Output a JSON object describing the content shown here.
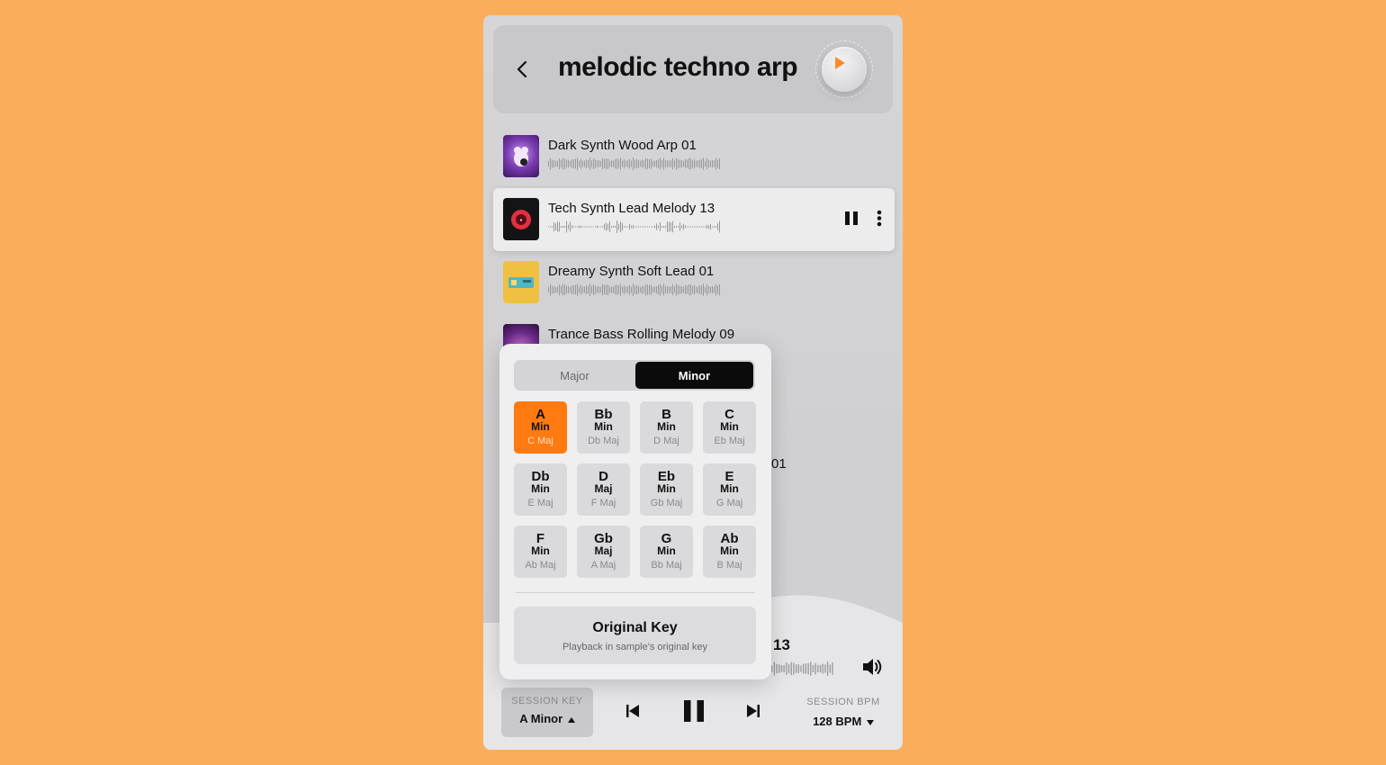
{
  "header": {
    "title": "melodic techno arp"
  },
  "tracks": [
    {
      "name": "Dark Synth Wood Arp 01",
      "active": false
    },
    {
      "name": "Tech Synth Lead Melody 13",
      "active": true
    },
    {
      "name": "Dreamy Synth Soft Lead 01",
      "active": false
    },
    {
      "name": "Trance Bass Rolling Melody 09",
      "active": false
    }
  ],
  "partial_text": {
    "row5_suffix": "01"
  },
  "now_playing": {
    "title_suffix": "13"
  },
  "session_key": {
    "label": "SESSION KEY",
    "value": "A Minor"
  },
  "session_bpm": {
    "label": "SESSION BPM",
    "value": "128 BPM"
  },
  "key_popup": {
    "tabs": {
      "major": "Major",
      "minor": "Minor"
    },
    "selected_tab": "Minor",
    "keys": [
      {
        "root": "A",
        "mode": "Min",
        "relative": "C Maj",
        "selected": true
      },
      {
        "root": "Bb",
        "mode": "Min",
        "relative": "Db Maj"
      },
      {
        "root": "B",
        "mode": "Min",
        "relative": "D Maj"
      },
      {
        "root": "C",
        "mode": "Min",
        "relative": "Eb Maj"
      },
      {
        "root": "Db",
        "mode": "Min",
        "relative": "E Maj"
      },
      {
        "root": "D",
        "mode": "Maj",
        "relative": "F Maj"
      },
      {
        "root": "Eb",
        "mode": "Min",
        "relative": "Gb Maj"
      },
      {
        "root": "E",
        "mode": "Min",
        "relative": "G Maj"
      },
      {
        "root": "F",
        "mode": "Min",
        "relative": "Ab Maj"
      },
      {
        "root": "Gb",
        "mode": "Maj",
        "relative": "A Maj"
      },
      {
        "root": "G",
        "mode": "Min",
        "relative": "Bb Maj"
      },
      {
        "root": "Ab",
        "mode": "Min",
        "relative": "B Maj"
      }
    ],
    "original_key": {
      "title": "Original Key",
      "subtitle": "Playback in sample's original key"
    }
  },
  "colors": {
    "background": "#FBAD5B",
    "accent": "#FF7A10"
  },
  "icons": [
    "back-icon",
    "play-icon",
    "pause-icon",
    "more-icon",
    "volume-icon",
    "skip-previous-icon",
    "skip-next-icon",
    "caret-up-icon",
    "caret-down-icon"
  ]
}
